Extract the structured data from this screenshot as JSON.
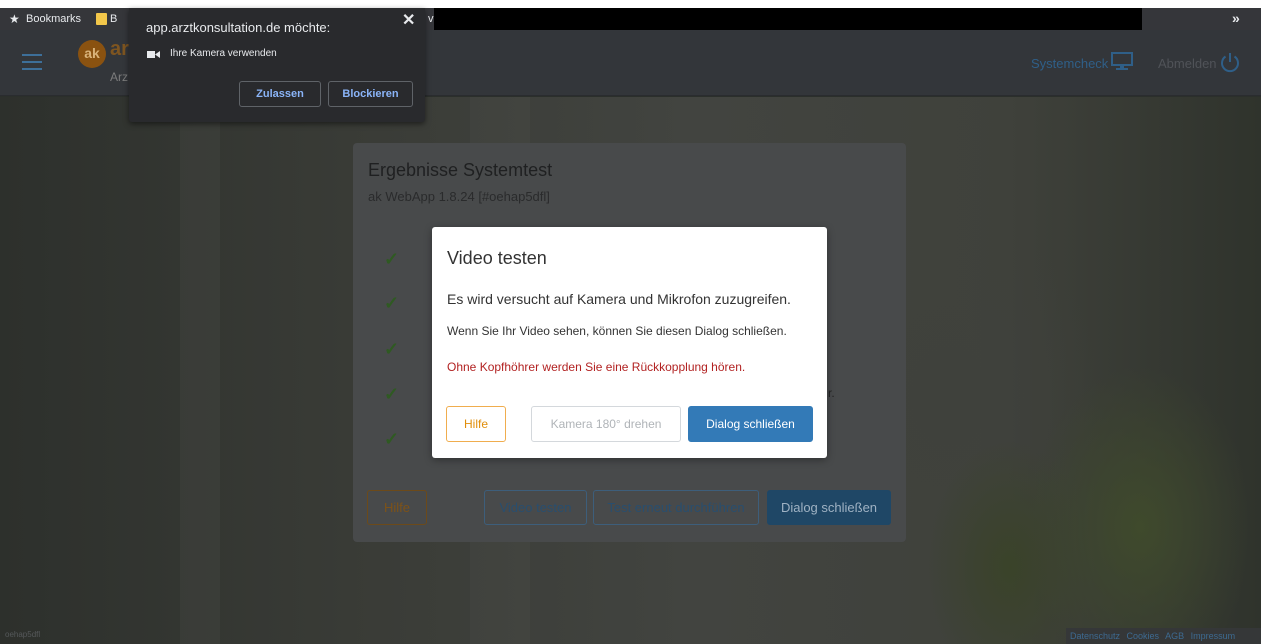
{
  "browser": {
    "bookmarks_label": "Bookmarks",
    "folder_label": "B",
    "extra_label": "v",
    "overflow_label": "»"
  },
  "permission": {
    "title": "app.arztkonsultation.de möchte:",
    "close": "✕",
    "request": "Ihre Kamera verwenden",
    "allow": "Zulassen",
    "block": "Blockieren"
  },
  "navbar": {
    "logo_mark": "ak",
    "logo_text": "ar",
    "logo_sub": "Arz",
    "systemcheck": "Systemcheck",
    "logout": "Abmelden"
  },
  "panel": {
    "title": "Ergebnisse Systemtest",
    "subtitle": "ak WebApp 1.8.24 [#oehap5dfl]",
    "check_mark": "✓",
    "stray_char": "r.",
    "buttons": {
      "help": "Hilfe",
      "video": "Video testen",
      "retest": "Test erneut durchführen",
      "close": "Dialog schließen"
    }
  },
  "modal": {
    "title": "Video testen",
    "line1": "Es wird versucht auf Kamera und Mikrofon zuzugreifen.",
    "line2": "Wenn Sie Ihr Video sehen, können Sie diesen Dialog schließen.",
    "line3": "Ohne Kopfhöhrer werden Sie eine Rückkopplung hören.",
    "buttons": {
      "help": "Hilfe",
      "rotate": "Kamera 180° drehen",
      "close": "Dialog schließen"
    }
  },
  "footer": {
    "session_id": "oehap5dfl",
    "links": [
      "Datenschutz",
      "Cookies",
      "AGB",
      "Impressum"
    ]
  },
  "colors": {
    "primary": "#337ab7",
    "warning": "#f0ad4e",
    "danger_text": "#b22222",
    "check_green": "#2f5a22"
  }
}
